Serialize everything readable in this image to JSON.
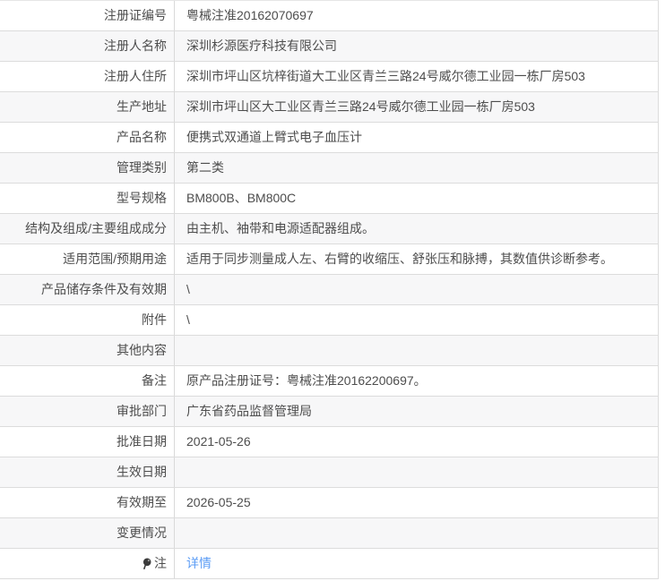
{
  "link_color": "#5b9cf5",
  "colors": {
    "row_alt_bg": "#f7f7f8",
    "border": "#dcdcdc",
    "text": "#4d4d4d"
  },
  "table": {
    "rows": [
      {
        "label": "注册证编号",
        "value": "粤械注准20162070697"
      },
      {
        "label": "注册人名称",
        "value": "深圳杉源医疗科技有限公司"
      },
      {
        "label": "注册人住所",
        "value": "深圳市坪山区坑梓街道大工业区青兰三路24号威尔德工业园一栋厂房503"
      },
      {
        "label": "生产地址",
        "value": "深圳市坪山区大工业区青兰三路24号威尔德工业园一栋厂房503"
      },
      {
        "label": "产品名称",
        "value": "便携式双通道上臂式电子血压计"
      },
      {
        "label": "管理类别",
        "value": "第二类"
      },
      {
        "label": "型号规格",
        "value": "BM800B、BM800C"
      },
      {
        "label": "结构及组成/主要组成成分",
        "value": "由主机、袖带和电源适配器组成。"
      },
      {
        "label": "适用范围/预期用途",
        "value": "适用于同步测量成人左、右臂的收缩压、舒张压和脉搏，其数值供诊断参考。"
      },
      {
        "label": "产品储存条件及有效期",
        "value": "\\"
      },
      {
        "label": "附件",
        "value": "\\"
      },
      {
        "label": "其他内容",
        "value": ""
      },
      {
        "label": "备注",
        "value": "原产品注册证号：粤械注准20162200697。"
      },
      {
        "label": "审批部门",
        "value": "广东省药品监督管理局"
      },
      {
        "label": "批准日期",
        "value": "2021-05-26"
      },
      {
        "label": "生效日期",
        "value": ""
      },
      {
        "label": "有效期至",
        "value": "2026-05-25"
      },
      {
        "label": "变更情况",
        "value": ""
      },
      {
        "label": "注",
        "value": "详情",
        "icon": "note-icon",
        "link": true
      }
    ]
  }
}
